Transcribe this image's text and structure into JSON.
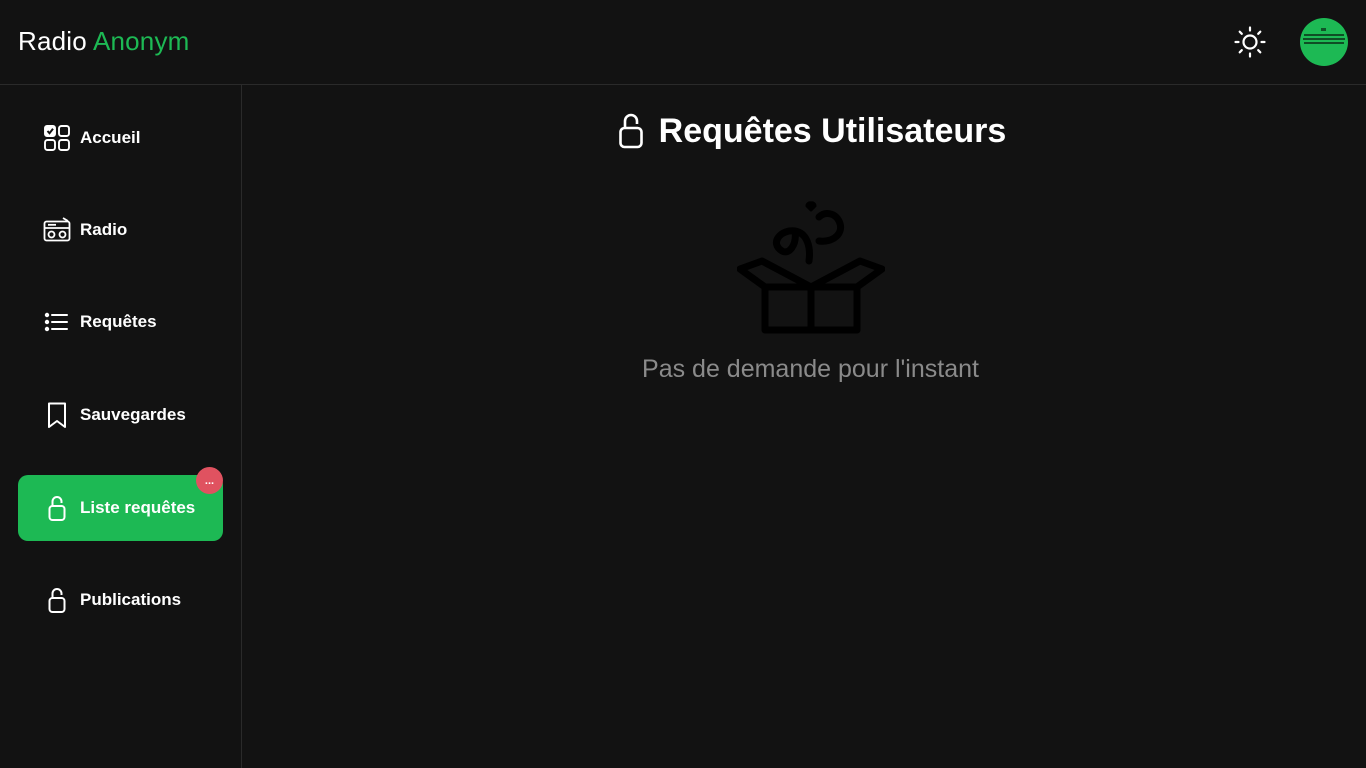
{
  "app": {
    "brand_first": "Radio",
    "brand_second": "Anonym",
    "accent_color": "#1db954"
  },
  "header": {
    "theme_toggle_icon": "sun-icon",
    "avatar_color": "#1db954"
  },
  "sidebar": {
    "items": [
      {
        "label": "Accueil",
        "icon": "dashboard-icon",
        "active": false
      },
      {
        "label": "Radio",
        "icon": "radio-icon",
        "active": false
      },
      {
        "label": "Requêtes",
        "icon": "list-icon",
        "active": false
      },
      {
        "label": "Sauvegardes",
        "icon": "bookmark-icon",
        "active": false
      },
      {
        "label": "Liste requêtes",
        "icon": "lock-icon",
        "active": true,
        "badge": "..."
      },
      {
        "label": "Publications",
        "icon": "lock-icon",
        "active": false
      }
    ]
  },
  "main": {
    "title_icon": "lock-icon",
    "title": "Requêtes Utilisateurs",
    "empty_icon": "gift-box-icon",
    "empty_message": "Pas de demande pour l'instant"
  }
}
